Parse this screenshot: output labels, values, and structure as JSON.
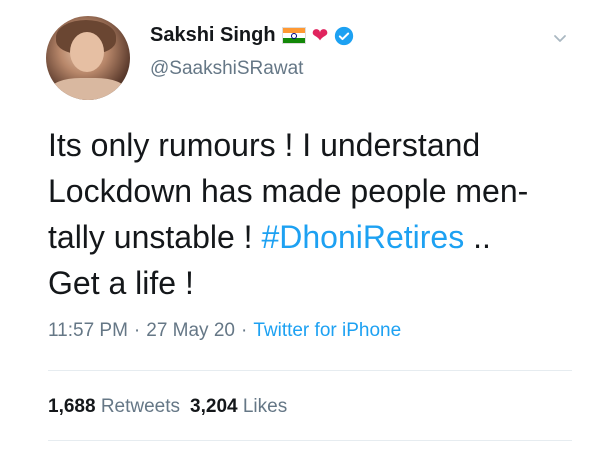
{
  "user": {
    "display_name": "Sakshi Singh",
    "handle": "@SaakshiSRawat",
    "badges": [
      "india-flag-icon",
      "red-heart-icon",
      "verified-icon"
    ]
  },
  "tweet": {
    "line1": "Its only rumours ! I understand",
    "line2": "Lockdown has made people men-",
    "line3_pre": "tally unstable ! ",
    "hashtag": "#DhoniRetires",
    "line3_post": " ..",
    "line4": "Get a life !"
  },
  "meta": {
    "time": "11:57 PM",
    "sep1": "·",
    "date": "27 May 20",
    "sep2": "·",
    "source": "Twitter for iPhone"
  },
  "stats": {
    "retweets_count": "1,688",
    "retweets_label": "Retweets",
    "likes_count": "3,204",
    "likes_label": "Likes"
  },
  "colors": {
    "link": "#1da1f2",
    "muted": "#657786",
    "text": "#14171a",
    "heart": "#e0245e"
  }
}
